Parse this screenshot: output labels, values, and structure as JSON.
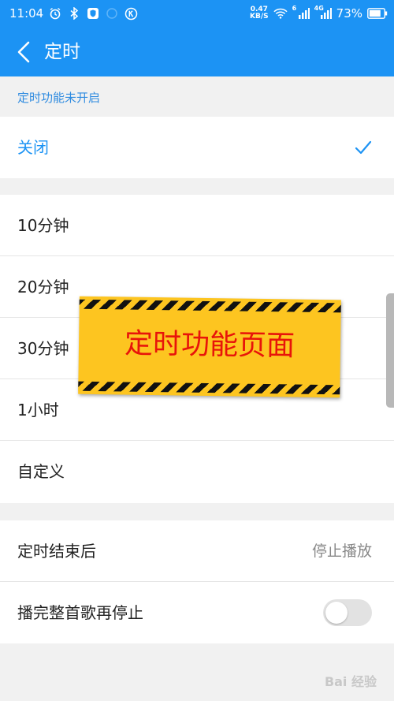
{
  "status_bar": {
    "time": "11:04",
    "net_speed_value": "0.47",
    "net_speed_unit": "KB/S",
    "signal1_label": "6",
    "signal2_label": "4G",
    "battery": "73%"
  },
  "header": {
    "title": "定时"
  },
  "section_note": "定时功能未开启",
  "options_off": {
    "label": "关闭",
    "selected": true
  },
  "timer_options": [
    {
      "label": "10分钟"
    },
    {
      "label": "20分钟"
    },
    {
      "label": "30分钟"
    },
    {
      "label": "1小时"
    },
    {
      "label": "自定义"
    }
  ],
  "settings": {
    "after_timer_label": "定时结束后",
    "after_timer_value": "停止播放",
    "finish_song_label": "播完整首歌再停止",
    "finish_song_enabled": false
  },
  "overlay": {
    "text": "定时功能页面"
  },
  "watermark": "Bai 经验",
  "colors": {
    "accent": "#1c93f4",
    "banner_yellow": "#fdc520",
    "banner_text": "#e8140a"
  }
}
